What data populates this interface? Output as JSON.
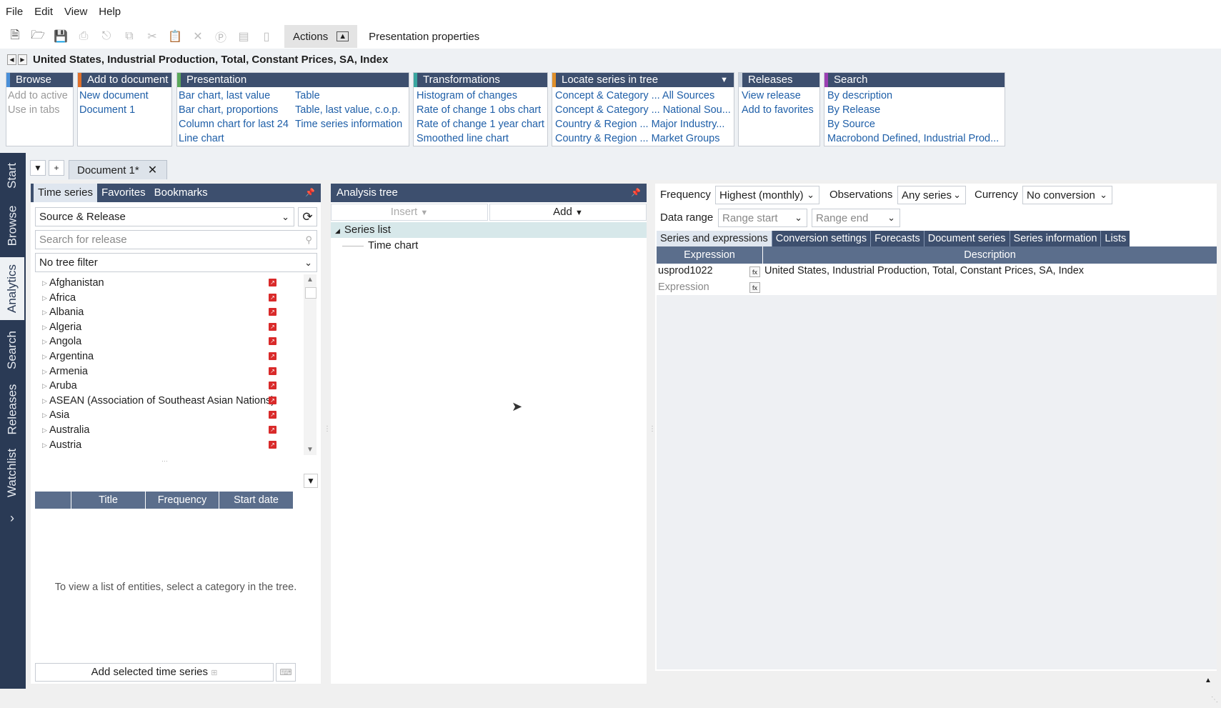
{
  "menu": [
    "File",
    "Edit",
    "View",
    "Help"
  ],
  "toolbar": {
    "icons": [
      "new-document-icon",
      "open-folder-icon",
      "save-icon",
      "print-icon",
      "share-icon",
      "copy-icon",
      "cut-icon",
      "paste-icon",
      "delete-icon",
      "p-icon",
      "chart-icon",
      "bar-icon"
    ],
    "actions_label": "Actions",
    "presentation_properties": "Presentation properties"
  },
  "series_title": "United States, Industrial Production, Total, Constant Prices, SA, Index",
  "ribbon": {
    "browse": {
      "title": "Browse",
      "items": [
        "Add to active",
        "Use in tabs"
      ]
    },
    "add_to_document": {
      "title": "Add to document",
      "items": [
        "New document",
        "Document 1"
      ]
    },
    "presentation": {
      "title": "Presentation",
      "col1": [
        "Bar chart, last value",
        "Bar chart, proportions",
        "Column chart for last 24",
        "Line chart"
      ],
      "col2": [
        "Table",
        "Table, last value, c.o.p.",
        "Time series information"
      ]
    },
    "transformations": {
      "title": "Transformations",
      "items": [
        "Histogram of changes",
        "Rate of change 1 obs chart",
        "Rate of change 1 year chart",
        "Smoothed line chart"
      ]
    },
    "locate": {
      "title": "Locate series in tree",
      "items": [
        "Concept & Category ... All Sources",
        "Concept & Category ... National Sou...",
        "Country & Region ... Major Industry...",
        "Country & Region ... Market Groups"
      ]
    },
    "releases": {
      "title": "Releases",
      "items": [
        "View release",
        "Add to favorites"
      ]
    },
    "search": {
      "title": "Search",
      "items": [
        "By description",
        "By Release",
        "By Source",
        "Macrobond Defined, Industrial Prod..."
      ]
    }
  },
  "side_tabs": [
    "Start",
    "Browse",
    "Analytics",
    "Search",
    "Releases",
    "Watchlist"
  ],
  "document_tab": "Document 1*",
  "left_panel": {
    "tabs": [
      "Time series",
      "Favorites",
      "Bookmarks"
    ],
    "source_select": "Source & Release",
    "search_placeholder": "Search for release",
    "tree_filter": "No tree filter",
    "tree_items": [
      "Afghanistan",
      "Africa",
      "Albania",
      "Algeria",
      "Angola",
      "Argentina",
      "Armenia",
      "Aruba",
      "ASEAN (Association of Southeast Asian Nations)",
      "Asia",
      "Australia",
      "Austria"
    ],
    "columns": [
      "Title",
      "Frequency",
      "Start date"
    ],
    "empty_message": "To view a list of entities, select a category in the tree.",
    "add_button": "Add selected time series"
  },
  "analysis_tree": {
    "title": "Analysis tree",
    "insert_label": "Insert",
    "add_label": "Add",
    "nodes": [
      "Series list",
      "Time chart"
    ]
  },
  "right_panel": {
    "frequency_label": "Frequency",
    "frequency_value": "Highest (monthly)",
    "observations_label": "Observations",
    "observations_value": "Any series",
    "currency_label": "Currency",
    "currency_value": "No conversion",
    "data_range_label": "Data range",
    "range_start_placeholder": "Range start",
    "range_end_placeholder": "Range end",
    "tabs": [
      "Series and expressions",
      "Conversion settings",
      "Forecasts",
      "Document series",
      "Series information",
      "Lists"
    ],
    "columns": [
      "Expression",
      "Description"
    ],
    "rows": [
      {
        "expression": "usprod1022",
        "description": "United States, Industrial Production, Total, Constant Prices, SA, Index"
      },
      {
        "expression": "Expression",
        "description": ""
      }
    ]
  }
}
